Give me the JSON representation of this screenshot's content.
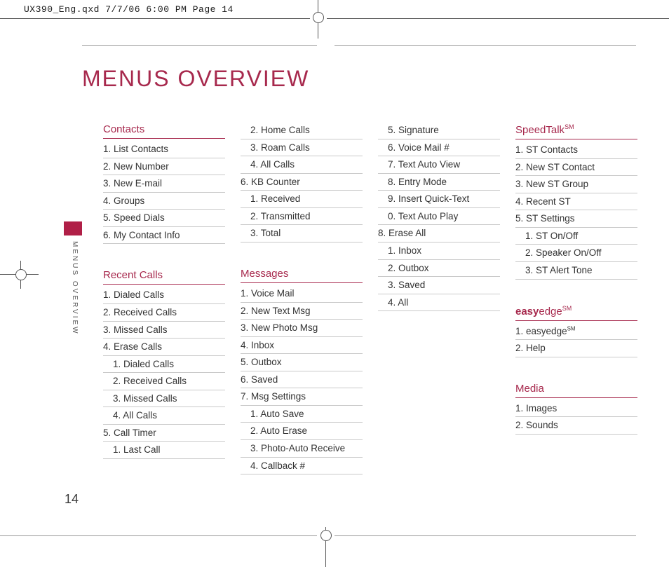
{
  "slug": "UX390_Eng.qxd  7/7/06  6:00 PM  Page 14",
  "title": "MENUS OVERVIEW",
  "side_label": "MENUS OVERVIEW",
  "page_number": "14",
  "col1": {
    "contacts_head": "Contacts",
    "contacts": [
      "1. List Contacts",
      "2. New Number",
      "3. New E-mail",
      "4. Groups",
      "5. Speed Dials",
      "6. My Contact Info"
    ],
    "recent_head": "Recent Calls",
    "recent": [
      "1. Dialed Calls",
      "2. Received Calls",
      "3. Missed Calls",
      "4. Erase Calls"
    ],
    "recent_sub": [
      "1. Dialed Calls",
      "2. Received Calls",
      "3. Missed Calls",
      "4. All Calls"
    ],
    "recent2": [
      "5. Call Timer"
    ],
    "recent2_sub": [
      "1. Last Call"
    ]
  },
  "col2": {
    "top_sub": [
      "2. Home Calls",
      "3. Roam Calls",
      "4. All Calls"
    ],
    "kb": [
      "6. KB Counter"
    ],
    "kb_sub": [
      "1. Received",
      "2. Transmitted",
      "3. Total"
    ],
    "messages_head": "Messages",
    "messages": [
      "1. Voice Mail",
      "2. New Text Msg",
      "3. New Photo Msg",
      "4. Inbox",
      "5. Outbox",
      "6. Saved",
      "7. Msg Settings"
    ],
    "messages_sub": [
      "1. Auto Save",
      "2. Auto Erase",
      "3. Photo-Auto Receive",
      "4. Callback #"
    ]
  },
  "col3": {
    "top_sub": [
      "5. Signature",
      "6. Voice Mail #",
      "7. Text Auto View",
      "8. Entry Mode",
      "9. Insert Quick-Text",
      "0. Text Auto Play"
    ],
    "erase": [
      "8. Erase All"
    ],
    "erase_sub": [
      "1. Inbox",
      "2. Outbox",
      "3. Saved",
      "4. All"
    ]
  },
  "col4": {
    "speedtalk_head": "SpeedTalk",
    "speedtalk_sup": "SM",
    "speedtalk": [
      "1. ST Contacts",
      "2. New ST Contact",
      "3. New ST Group",
      "4. Recent ST",
      "5. ST Settings"
    ],
    "speedtalk_sub": [
      "1. ST On/Off",
      "2. Speaker On/Off",
      "3. ST Alert Tone"
    ],
    "easy_bold": "easy",
    "easy_rest": "edge",
    "easy_sup": "SM",
    "easy_items_pre1": "1. ",
    "easy_items_1b": "easy",
    "easy_items_1r": "edge",
    "easy_items_1sup": "SM",
    "easy_items_2": "2. Help",
    "media_head": "Media",
    "media": [
      "1. Images",
      "2. Sounds"
    ]
  }
}
